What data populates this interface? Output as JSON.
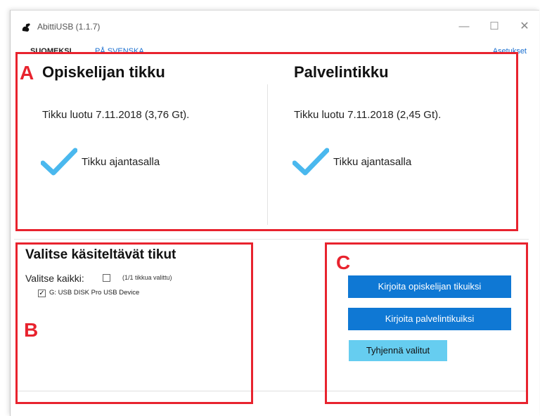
{
  "window": {
    "title": "AbittiUSB (1.1.7)",
    "controls": {
      "minimize": "—",
      "maximize": "☐",
      "close": "✕"
    }
  },
  "menu": {
    "lang_fi": "SUOMEKSI",
    "lang_sv": "PÅ SVENSKA",
    "settings": "Asetukset"
  },
  "annotations": {
    "a": "A",
    "b": "B",
    "c": "C"
  },
  "student_stick": {
    "title": "Opiskelijan tikku",
    "info": "Tikku luotu 7.11.2018 (3,76 Gt).",
    "status": "Tikku ajantasalla"
  },
  "server_stick": {
    "title": "Palvelintikku",
    "info": "Tikku luotu 7.11.2018 (2,45 Gt).",
    "status": "Tikku ajantasalla"
  },
  "selection": {
    "title": "Valitse käsiteltävät tikut",
    "select_all_label": "Valitse kaikki:",
    "count": "(1/1 tikkua valittu)",
    "devices": [
      {
        "label": "G: USB DISK Pro USB Device",
        "checked": true,
        "mark": "✓"
      }
    ]
  },
  "actions": {
    "write_student": "Kirjoita opiskelijan tikuiksi",
    "write_server": "Kirjoita palvelintikuiksi",
    "clear": "Tyhjennä valitut"
  },
  "colors": {
    "accent": "#0f78d4",
    "accent_light": "#66cdf0",
    "check": "#4ab8ee",
    "annotation_red": "#e8232e",
    "link": "#1a6fd0"
  }
}
